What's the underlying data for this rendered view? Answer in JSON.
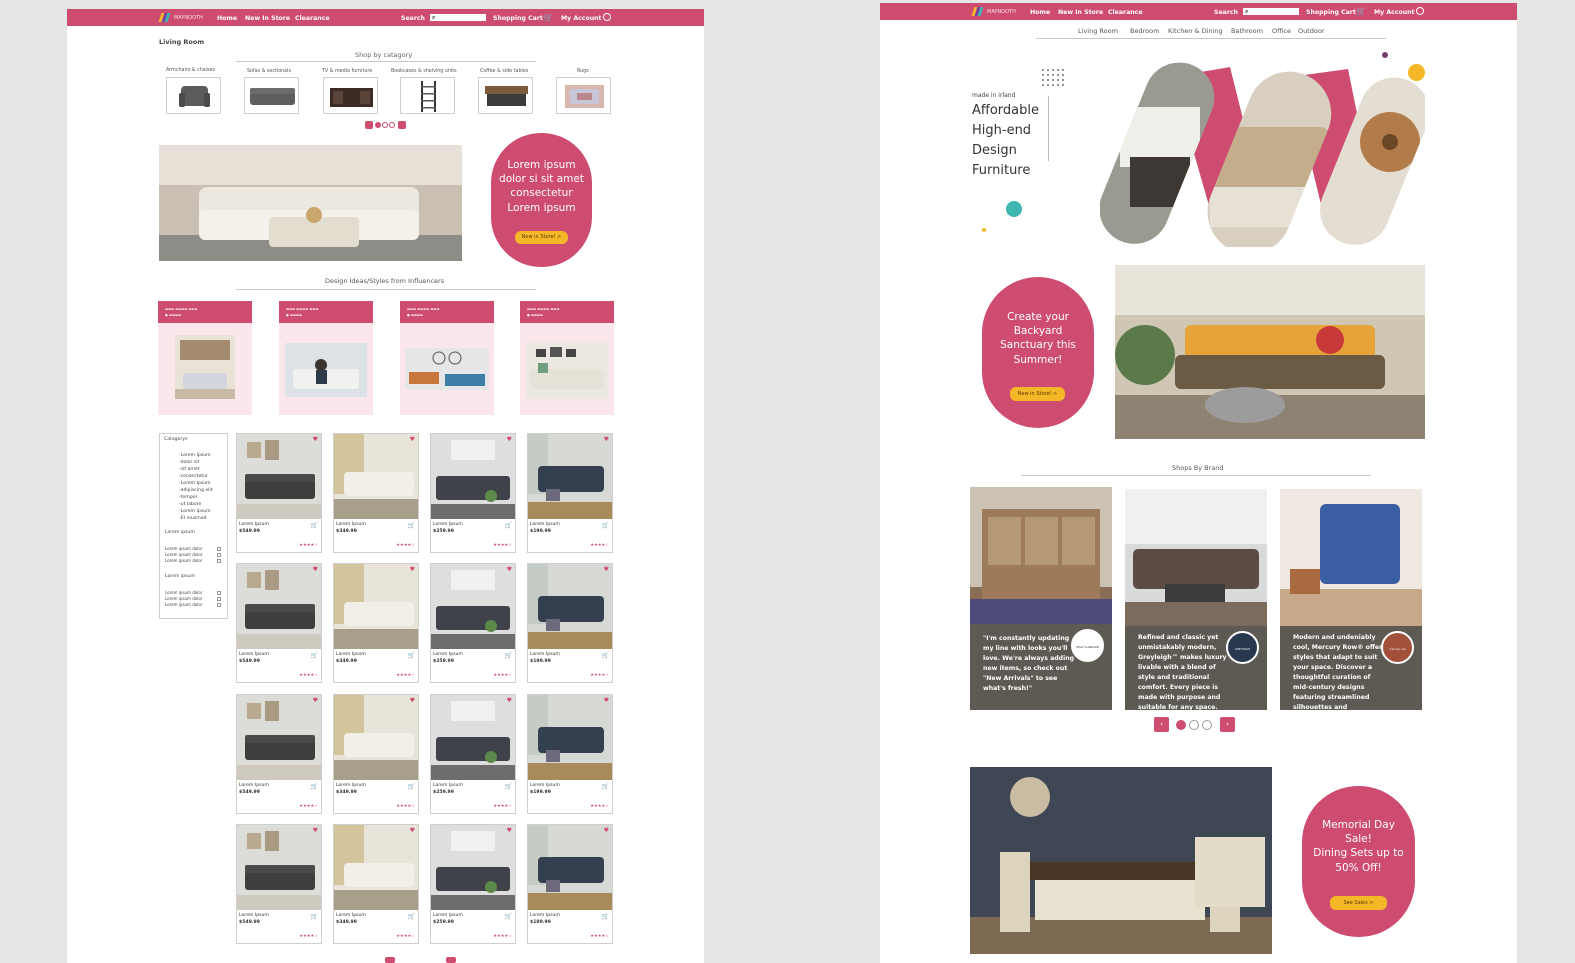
{
  "brand": {
    "logo_text": "MAYNOOTH"
  },
  "nav": {
    "home": "Home",
    "new": "New In Store",
    "clearance": "Clearance",
    "search": "Search",
    "cart": "Shopping Cart",
    "account": "My Account"
  },
  "colors": {
    "accent": "#cf4c71",
    "cta": "#f4b728",
    "card_bg": "#fbe6ec",
    "brand_panel": "#5c5a52"
  },
  "page1": {
    "breadcrumb": "Living Room",
    "categories_heading": "Shop by catagory",
    "categories": [
      "Armchairs & chaises",
      "Sofas & sectionals",
      "TV & media furniture",
      "Bookcases & shelving units",
      "Coffee & side tables",
      "Rugs"
    ],
    "promo": {
      "text_lines": [
        "Lorem ipsum",
        "dolor si sit amet",
        "consectetur",
        "Lorem ipsum"
      ],
      "button": "New in Store! >"
    },
    "influencers_heading": "Design Ideas/Styles from Influencers",
    "filter": {
      "title": "Catagorys",
      "items": [
        "-Lorem Ipsum",
        "-dolor sit",
        "-sit amet",
        "-consectetur",
        "-Lorem Ipsum",
        "-adipiscing elit",
        "-tempor",
        "-ut labore",
        "-Lorem Ipsum",
        "-Et eiusmod"
      ],
      "group1_title": "Lorem ipsum",
      "group1": [
        "Lorem ipsum dolor",
        "Lorem ipsum dolor",
        "Lorem ipsum dolor"
      ],
      "group2_title": "Lorem ipsum",
      "group2": [
        "Lorem ipsum dolor",
        "Lorem ipsum dolor",
        "Lorem ipsum dolor"
      ]
    },
    "product_name": "Lorem Ipsum",
    "prices": [
      "$549.99",
      "$349.99",
      "$259.99",
      "$199.99"
    ],
    "stars": "★★★★☆"
  },
  "page2": {
    "subnav": [
      "Living Room",
      "Bedroom",
      "Kitchen & Dining",
      "Bathroom",
      "Office",
      "Outdoor"
    ],
    "hero_small": "made in irland",
    "hero_lines": [
      "Affordable",
      "High-end",
      "Design",
      "Furniture"
    ],
    "backyard": {
      "lines": [
        "Create your",
        "Backyard",
        "Sanctuary this",
        "Summer!"
      ],
      "button": "New in Store! >"
    },
    "brands_heading": "Shops By Brand",
    "brands": [
      {
        "text": "\"I'm constantly updating my line with looks you'll love. We're always adding new items, so check out \"New Arrivals\" to see what's fresh!\"",
        "logo": "KELLY CLARKSON HOME"
      },
      {
        "text": "Refined and classic yet unmistakably modern, Greyleigh™ makes luxury livable with a blend of style and traditional comfort. Every piece is made with purpose and suitable for any space.",
        "logo": "GREYLEIGH"
      },
      {
        "text": "Modern and undeniably cool, Mercury Row® offers styles that adapt to suit your space. Discover a thoughtful curation of mid-century designs featuring streamlined silhouettes and",
        "logo": "mercury row"
      }
    ],
    "sale": {
      "lines": [
        "Memorial Day",
        "Sale!",
        "Dining Sets up to",
        "50% Off!"
      ],
      "button": "See Sales >"
    }
  }
}
